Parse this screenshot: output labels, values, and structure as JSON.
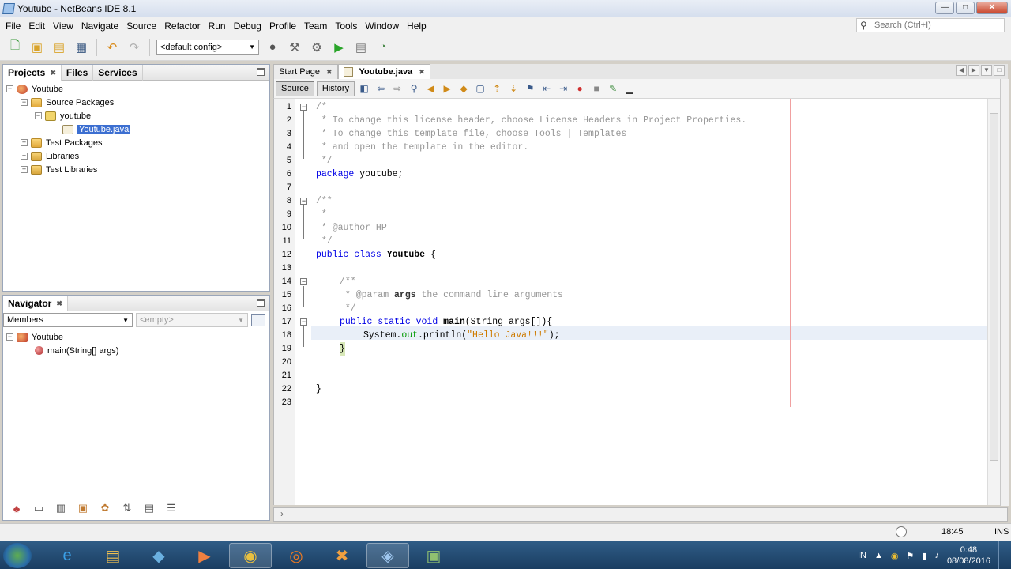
{
  "window": {
    "title": "Youtube - NetBeans IDE 8.1",
    "buttons": {
      "minimize": "—",
      "maximize": "□",
      "close": "✕"
    }
  },
  "menu": [
    "File",
    "Edit",
    "View",
    "Navigate",
    "Source",
    "Refactor",
    "Run",
    "Debug",
    "Profile",
    "Team",
    "Tools",
    "Window",
    "Help"
  ],
  "search": {
    "placeholder": "Search (Ctrl+I)"
  },
  "toolbar": {
    "config": "<default config>"
  },
  "projects_panel": {
    "tabs": [
      "Projects",
      "Files",
      "Services"
    ],
    "tree": {
      "root": "Youtube",
      "source_packages": "Source Packages",
      "package": "youtube",
      "file": "Youtube.java",
      "test_packages": "Test Packages",
      "libraries": "Libraries",
      "test_libraries": "Test Libraries"
    }
  },
  "navigator": {
    "title": "Navigator",
    "members": "Members",
    "filter": "<empty>",
    "root": "Youtube",
    "method": "main(String[] args)"
  },
  "editor": {
    "tabs": [
      "Start Page",
      "Youtube.java"
    ],
    "source_btn": "Source",
    "history_btn": "History",
    "line_numbers": [
      "1",
      "2",
      "3",
      "4",
      "5",
      "6",
      "7",
      "8",
      "9",
      "10",
      "11",
      "12",
      "13",
      "14",
      "15",
      "16",
      "17",
      "18",
      "19",
      "20",
      "21",
      "22",
      "23"
    ],
    "lines": {
      "l1": "/*",
      "l2": " * To change this license header, choose License Headers in Project Properties.",
      "l3": " * To change this template file, choose Tools | Templates",
      "l4": " * and open the template in the editor.",
      "l5": " */",
      "l6a": "package",
      "l6b": " youtube;",
      "l8": "/**",
      "l9": " *",
      "l10": " * @author HP",
      "l11": " */",
      "l12a": "public class",
      "l12b": "Youtube",
      "l12c": " {",
      "l14": "/**",
      "l15a": " * @param ",
      "l15b": "args",
      "l15c": " the command line arguments",
      "l16": " */",
      "l17a": "public static void",
      "l17b": "main",
      "l17c": "(String args[]){",
      "l18a": "System.",
      "l18b": "out",
      "l18c": ".println(",
      "l18d": "\"Hello Java!!!\"",
      "l18e": ");",
      "l19": "}",
      "l22": "}"
    }
  },
  "status": {
    "position": "18:45",
    "mode": "INS"
  },
  "taskbar": {
    "language": "IN",
    "time": "0:48",
    "date": "08/08/2016"
  }
}
